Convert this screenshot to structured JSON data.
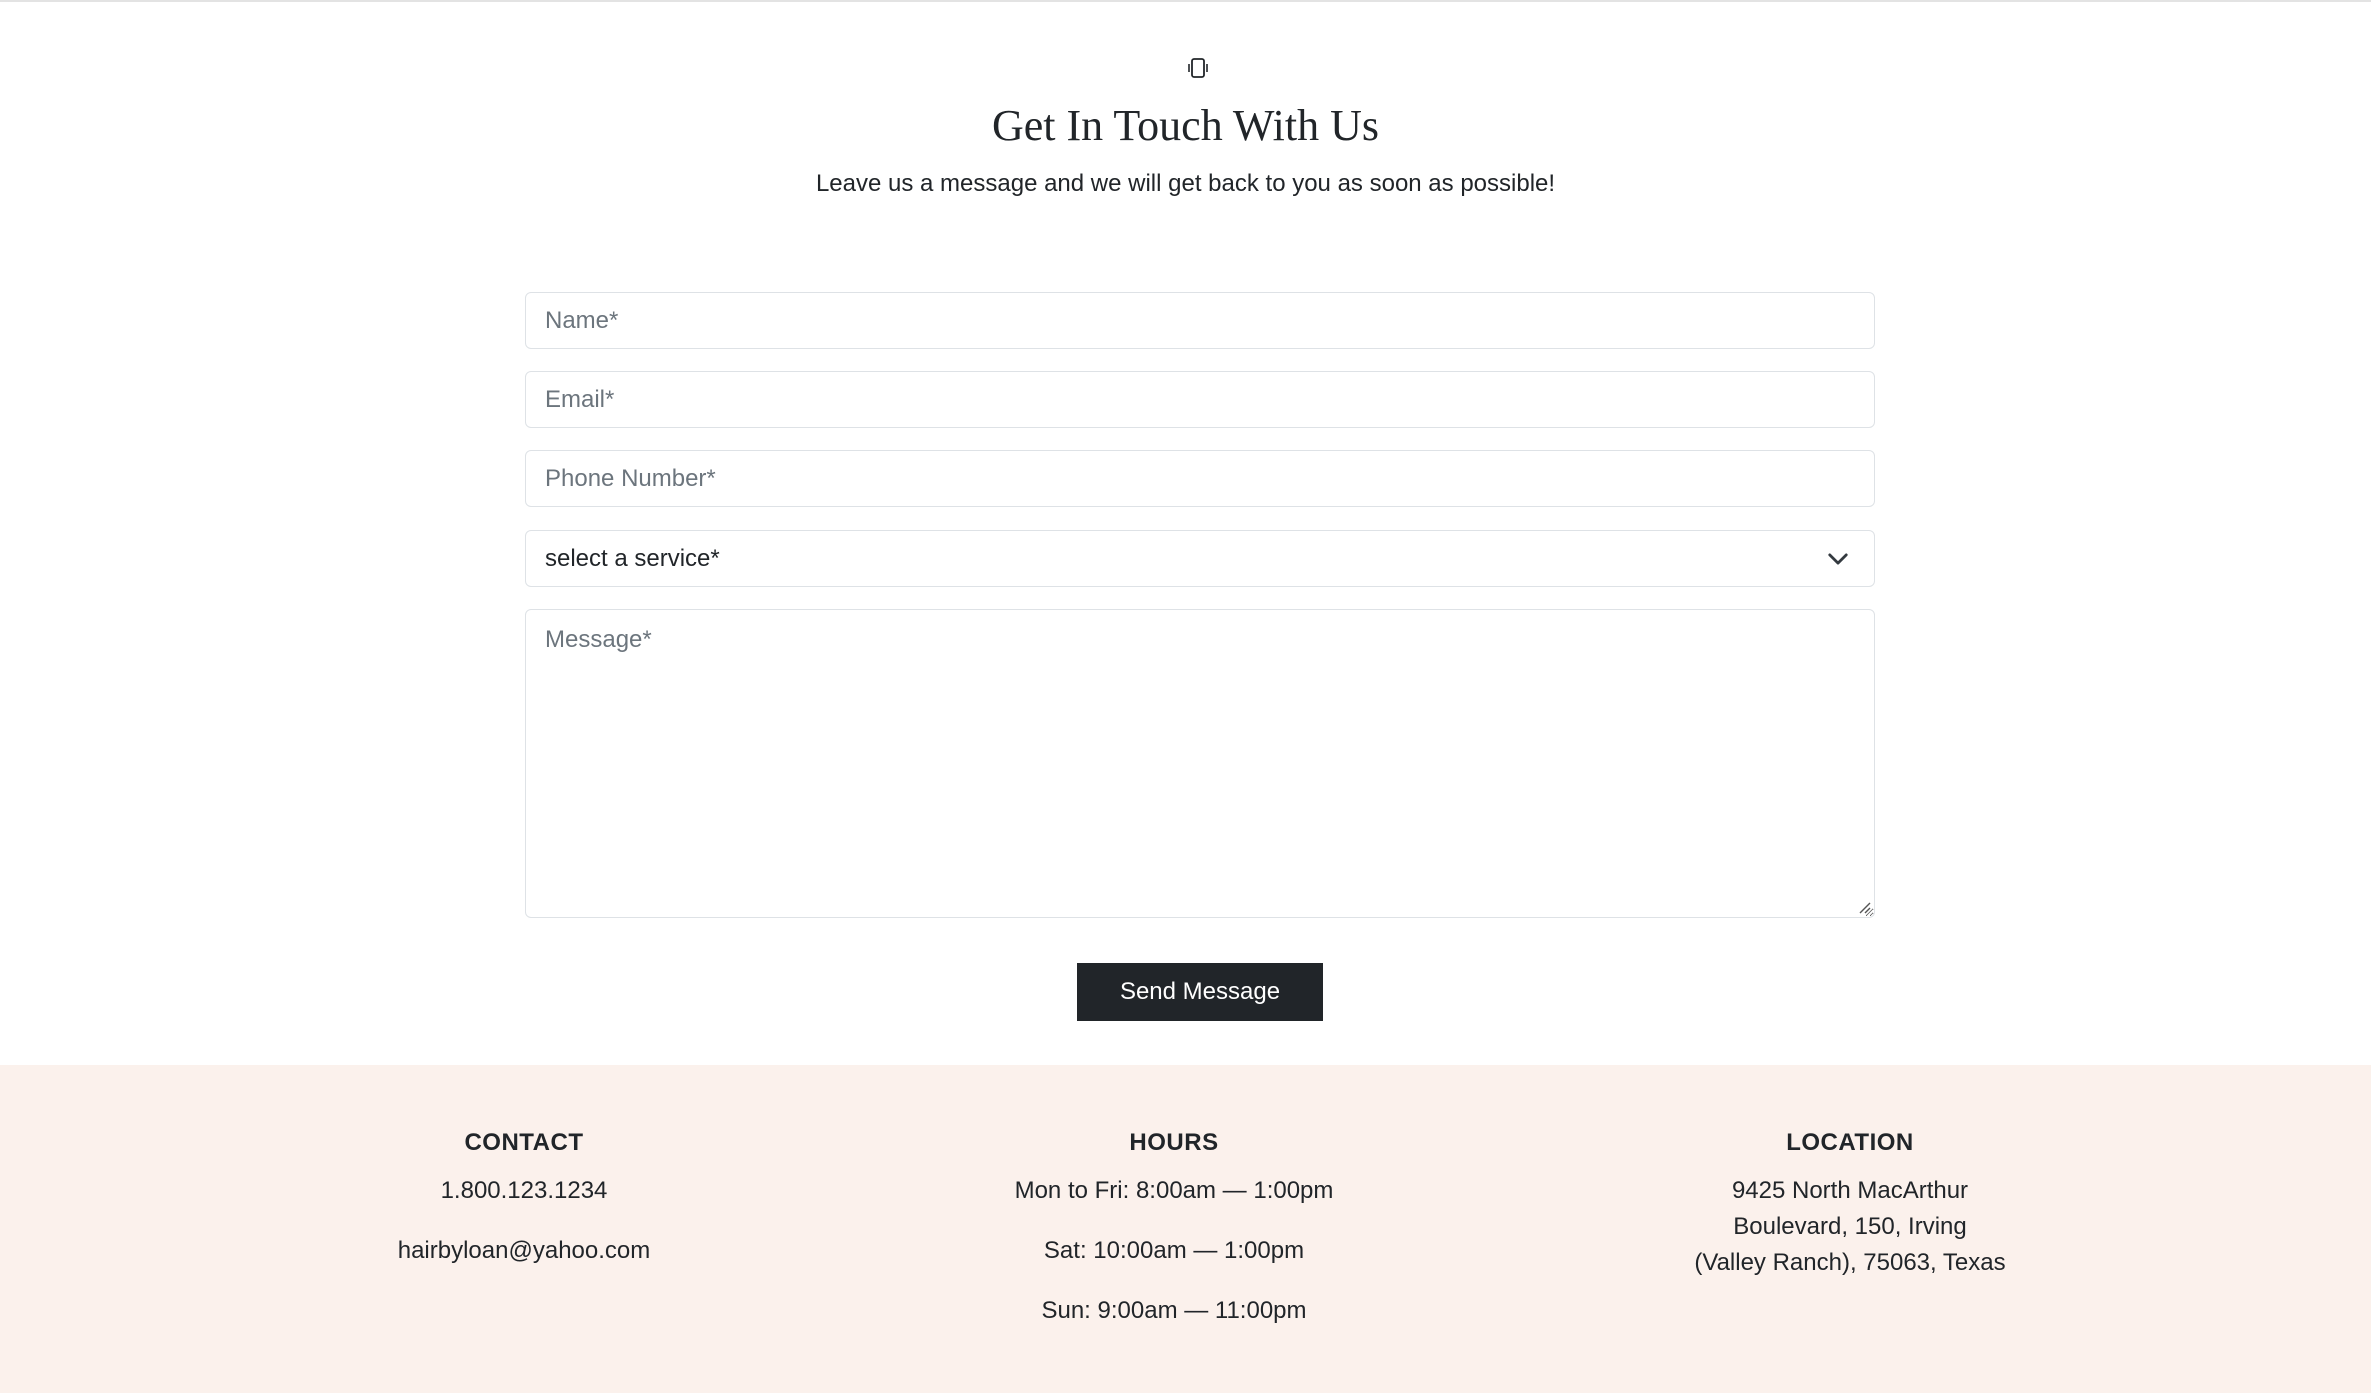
{
  "contact": {
    "icon": "phone-icon",
    "heading": "Get In Touch With Us",
    "subheading": "Leave us a message and we will get back to you as soon as possible!"
  },
  "form": {
    "name_placeholder": "Name*",
    "email_placeholder": "Email*",
    "phone_placeholder": "Phone Number*",
    "service_selected": "select a service*",
    "message_placeholder": "Message*",
    "submit_label": "Send Message"
  },
  "footer": {
    "contact": {
      "title": "CONTACT",
      "phone": "1.800.123.1234",
      "email": "hairbyloan@yahoo.com"
    },
    "hours": {
      "title": "HOURS",
      "lines": [
        "Mon to Fri: 8:00am — 1:00pm",
        "Sat: 10:00am — 1:00pm",
        "Sun: 9:00am — 11:00pm"
      ]
    },
    "location": {
      "title": "LOCATION",
      "lines": [
        "9425 North MacArthur",
        "Boulevard, 150, Irving",
        "(Valley Ranch), 75063, Texas"
      ]
    }
  },
  "colors": {
    "text": "#212529",
    "button_bg": "#212529",
    "footer_bg": "#fbf1ec",
    "input_border": "#dee2e6",
    "placeholder": "#6c757d"
  }
}
